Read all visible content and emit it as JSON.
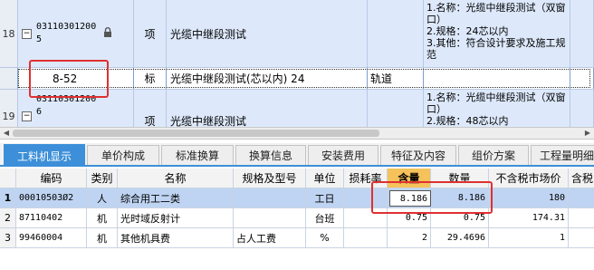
{
  "top_rows": [
    {
      "row_num": "18",
      "code_line1": "03110301200",
      "code_line2": "5",
      "expander": "−",
      "type": "项",
      "name": "光缆中继段测试",
      "notes": [
        "1.名称：光缆中继段测试（双窗口）",
        "2.规格：24芯以内",
        "3.其他：符合设计要求及施工规范"
      ]
    },
    {
      "row_num": "",
      "code": "8-52",
      "type": "标",
      "name": "光缆中继段测试(芯以内) 24",
      "unit_col": "轨道"
    },
    {
      "row_num": "19",
      "code_line1": "03110301200",
      "code_line2": "6",
      "expander": "−",
      "type": "项",
      "name": "光缆中继段测试",
      "notes": [
        "1.名称：光缆中继段测试（双窗口）",
        "2.规格：48芯以内"
      ]
    }
  ],
  "tabs": [
    "工料机显示",
    "单价构成",
    "标准换算",
    "换算信息",
    "安装费用",
    "特征及内容",
    "组价方案",
    "工程量明细"
  ],
  "columns": [
    "",
    "编码",
    "类别",
    "名称",
    "规格及型号",
    "单位",
    "损耗率",
    "含量",
    "数量",
    "不含税市场价",
    "含税"
  ],
  "rows": [
    {
      "num": "1",
      "code": "00010503Ø2",
      "type": "人",
      "name": "综合用工二类",
      "spec": "",
      "unit": "工日",
      "loss": "",
      "content": "8.186",
      "qty": "8.186",
      "price": "180",
      "tax": ""
    },
    {
      "num": "2",
      "code": "87110402",
      "type": "机",
      "name": "光时域反射计",
      "spec": "",
      "unit": "台班",
      "loss": "",
      "content": "0.75",
      "qty": "0.75",
      "price": "174.31",
      "tax": ""
    },
    {
      "num": "3",
      "code": "99460004",
      "type": "机",
      "name": "其他机具费",
      "spec": "占人工费",
      "unit": "%",
      "loss": "",
      "content": "2",
      "qty": "29.4696",
      "price": "1",
      "tax": ""
    }
  ],
  "colors": {
    "accent": "#3c8fd8",
    "header_highlight": "#f5c25b",
    "annotation": "#e03030",
    "selected_row": "#bfd4f2"
  }
}
